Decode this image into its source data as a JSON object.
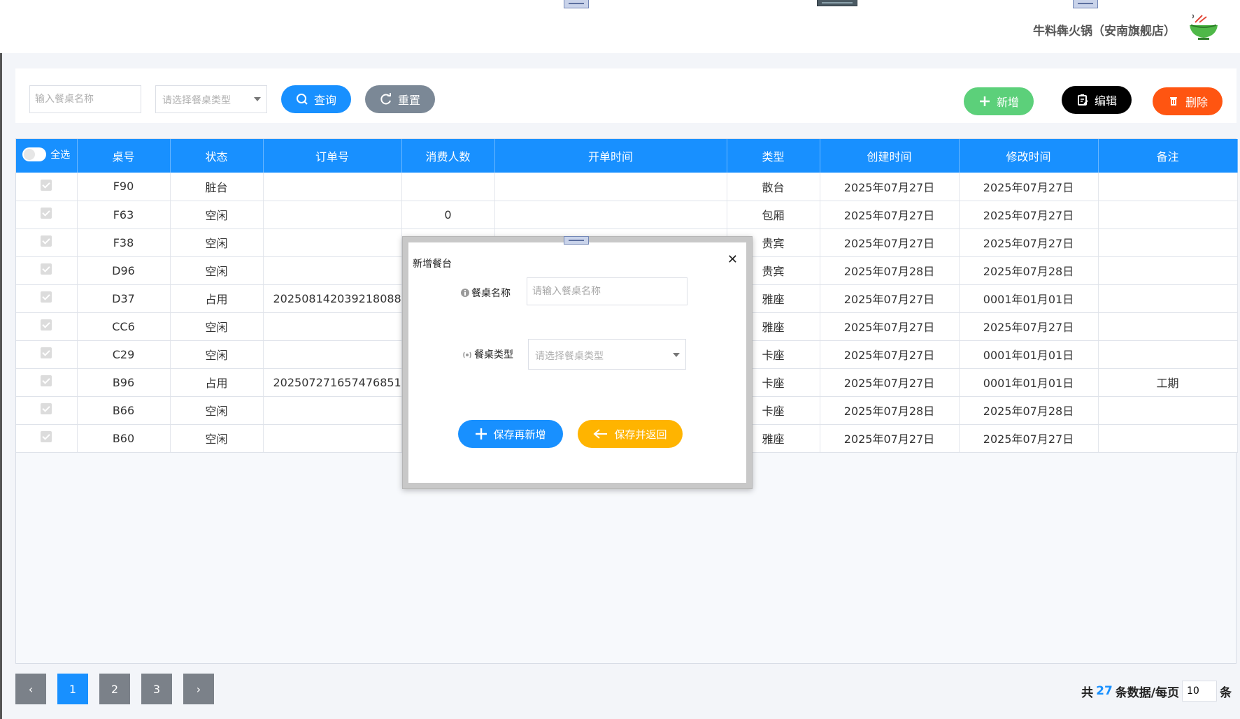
{
  "header": {
    "shop_name": "牛料犇火锅（安南旗舰店）"
  },
  "toolbar": {
    "name_placeholder": "输入餐桌名称",
    "type_placeholder": "请选择餐桌类型",
    "query_label": "查询",
    "reset_label": "重置",
    "add_label": "新增",
    "edit_label": "编辑",
    "delete_label": "删除"
  },
  "table": {
    "select_all_label": "全选",
    "columns": [
      "桌号",
      "状态",
      "订单号",
      "消费人数",
      "开单时间",
      "类型",
      "创建时间",
      "修改时间",
      "备注"
    ],
    "rows": [
      {
        "table_no": "F90",
        "status": "脏台",
        "order_no": "",
        "guests": "",
        "open_time": "",
        "type": "散台",
        "created": "2025年07月27日",
        "modified": "2025年07月27日",
        "note": ""
      },
      {
        "table_no": "F63",
        "status": "空闲",
        "order_no": "",
        "guests": "0",
        "open_time": "",
        "type": "包厢",
        "created": "2025年07月27日",
        "modified": "2025年07月27日",
        "note": ""
      },
      {
        "table_no": "F38",
        "status": "空闲",
        "order_no": "",
        "guests": "",
        "open_time": "",
        "type": "贵宾",
        "created": "2025年07月27日",
        "modified": "2025年07月27日",
        "note": ""
      },
      {
        "table_no": "D96",
        "status": "空闲",
        "order_no": "",
        "guests": "",
        "open_time": "",
        "type": "贵宾",
        "created": "2025年07月28日",
        "modified": "2025年07月28日",
        "note": ""
      },
      {
        "table_no": "D37",
        "status": "占用",
        "order_no": "202508142039218088",
        "guests": "",
        "open_time": "",
        "type": "雅座",
        "created": "2025年07月27日",
        "modified": "0001年01月01日",
        "note": ""
      },
      {
        "table_no": "CC6",
        "status": "空闲",
        "order_no": "",
        "guests": "",
        "open_time": "",
        "type": "雅座",
        "created": "2025年07月27日",
        "modified": "2025年07月27日",
        "note": ""
      },
      {
        "table_no": "C29",
        "status": "空闲",
        "order_no": "",
        "guests": "",
        "open_time": "",
        "type": "卡座",
        "created": "2025年07月27日",
        "modified": "0001年01月01日",
        "note": ""
      },
      {
        "table_no": "B96",
        "status": "占用",
        "order_no": "202507271657476851",
        "guests": "",
        "open_time": "",
        "type": "卡座",
        "created": "2025年07月27日",
        "modified": "0001年01月01日",
        "note": "工期"
      },
      {
        "table_no": "B66",
        "status": "空闲",
        "order_no": "",
        "guests": "",
        "open_time": "",
        "type": "卡座",
        "created": "2025年07月28日",
        "modified": "2025年07月28日",
        "note": ""
      },
      {
        "table_no": "B60",
        "status": "空闲",
        "order_no": "",
        "guests": "",
        "open_time": "",
        "type": "雅座",
        "created": "2025年07月27日",
        "modified": "2025年07月27日",
        "note": ""
      }
    ]
  },
  "pagination": {
    "prev": "‹",
    "next": "›",
    "pages": [
      "1",
      "2",
      "3"
    ],
    "current": "1",
    "total_prefix": "共",
    "total": "27",
    "total_suffix": "条数据/每页",
    "page_size": "10",
    "unit": "条"
  },
  "modal": {
    "title": "新增餐台",
    "close": "✕",
    "name_label": "餐桌名称",
    "name_placeholder": "请输入餐桌名称",
    "type_label": "餐桌类型",
    "type_placeholder": "请选择餐桌类型",
    "save_new_label": "保存再新增",
    "save_back_label": "保存并返回"
  },
  "colors": {
    "primary": "#1890ff",
    "add": "#5cd07a",
    "delete": "#ff5511",
    "reset": "#7b8896",
    "save_back": "#ffb400"
  }
}
